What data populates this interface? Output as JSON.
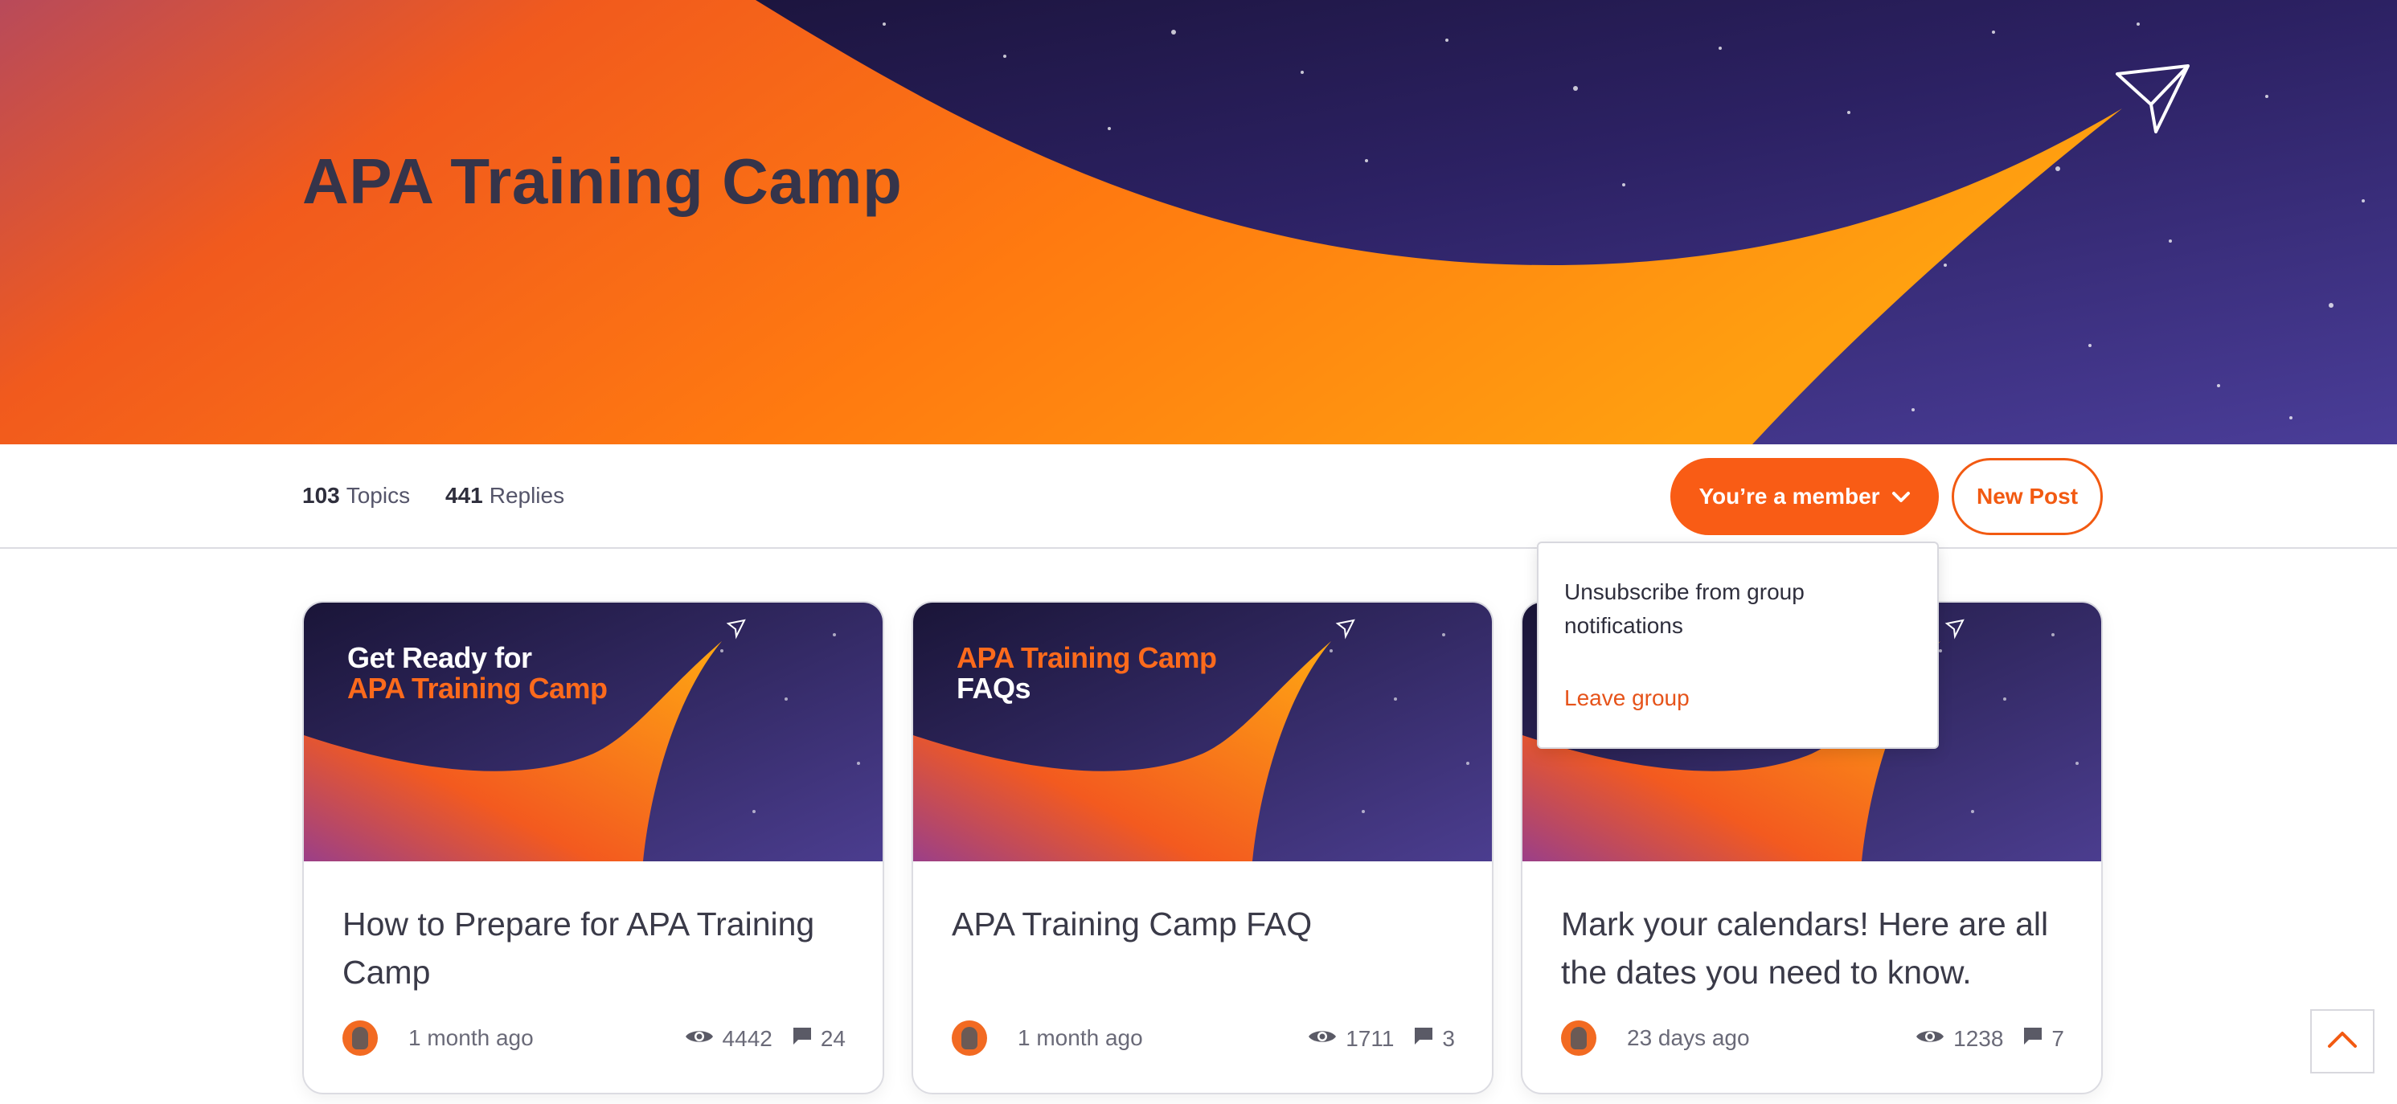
{
  "hero": {
    "title": "APA Training Camp"
  },
  "stats": {
    "topics_count": "103",
    "topics_label": "Topics",
    "replies_count": "441",
    "replies_label": "Replies"
  },
  "actions": {
    "member_label": "You’re a member",
    "new_post_label": "New Post"
  },
  "dropdown": {
    "unsubscribe_label": "Unsubscribe from group notifications",
    "leave_label": "Leave group"
  },
  "cards": [
    {
      "banner_line1": "Get Ready for",
      "banner_line2": "APA Training Camp",
      "title": "How to Prepare for APA Training Camp",
      "time": "1 month ago",
      "views": "4442",
      "comments": "24"
    },
    {
      "banner_line1": "APA Training Camp",
      "banner_line2": "FAQs",
      "title": "APA Training Camp FAQ",
      "time": "1 month ago",
      "views": "1711",
      "comments": "3"
    },
    {
      "banner_line1": "",
      "banner_line2": "",
      "title": "Mark your calendars! Here are all the dates you need to know.",
      "time": "23 days ago",
      "views": "1238",
      "comments": "7"
    }
  ],
  "colors": {
    "accent": "#f95c15",
    "title": "#35344a",
    "space": "#2a1f55"
  },
  "icons": [
    "paper-plane-icon",
    "chevron-down-icon",
    "eye-icon",
    "comment-icon",
    "chevron-up-icon"
  ]
}
